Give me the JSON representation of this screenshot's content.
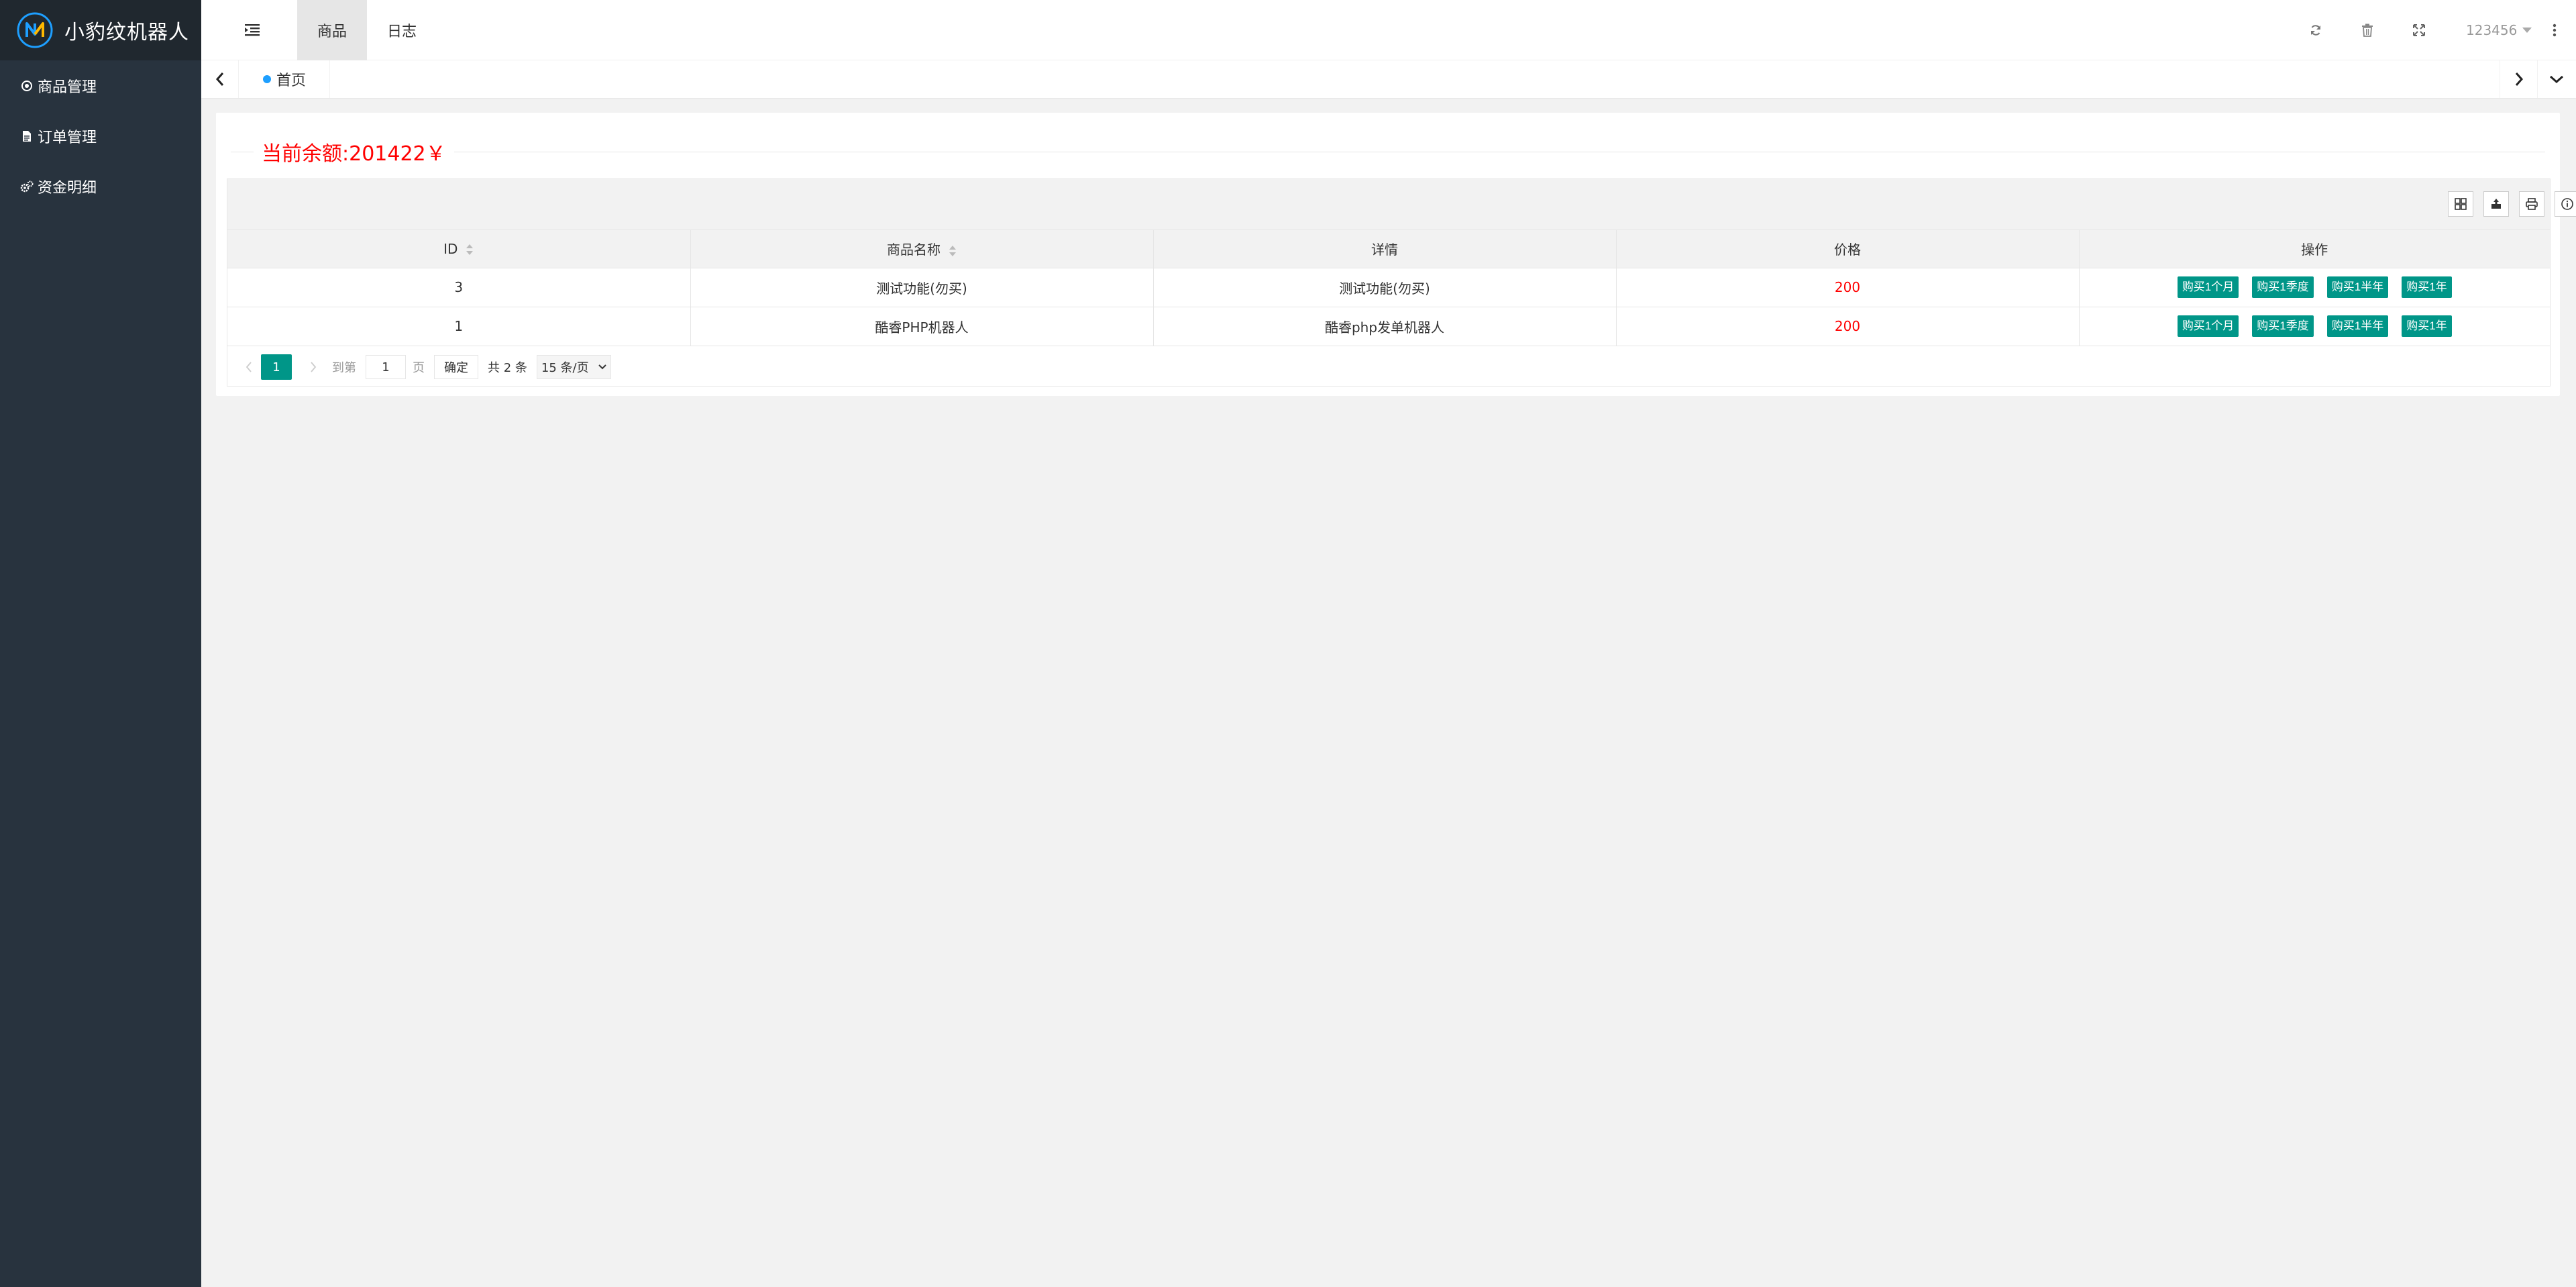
{
  "app": {
    "title": "小豹纹机器人"
  },
  "sidebar": {
    "items": [
      {
        "label": "商品管理",
        "icon": "circle-dot-icon"
      },
      {
        "label": "订单管理",
        "icon": "file-icon"
      },
      {
        "label": "资金明细",
        "icon": "gears-icon"
      }
    ]
  },
  "header": {
    "tabs": [
      {
        "label": "商品",
        "active": true
      },
      {
        "label": "日志",
        "active": false
      }
    ],
    "tools": [
      "refresh-icon",
      "trash-icon",
      "fullscreen-icon"
    ],
    "user": "123456"
  },
  "tabbar": {
    "home": "首页"
  },
  "balance": {
    "text": "当前余额:201422￥"
  },
  "table": {
    "columns": [
      {
        "label": "ID",
        "sortable": true
      },
      {
        "label": "商品名称",
        "sortable": true
      },
      {
        "label": "详情",
        "sortable": false
      },
      {
        "label": "价格",
        "sortable": false
      },
      {
        "label": "操作",
        "sortable": false
      }
    ],
    "rows": [
      {
        "id": "3",
        "name": "测试功能(勿买)",
        "detail": "测试功能(勿买)",
        "price": "200"
      },
      {
        "id": "1",
        "name": "酷睿PHP机器人",
        "detail": "酷睿php发单机器人",
        "price": "200"
      }
    ],
    "actions": [
      "购买1个月",
      "购买1季度",
      "购买1半年",
      "购买1年"
    ],
    "toolbar_icons": [
      "columns-icon",
      "export-icon",
      "print-icon",
      "info-icon"
    ]
  },
  "pager": {
    "current": "1",
    "goto_prefix": "到第",
    "goto_value": "1",
    "goto_suffix": "页",
    "confirm": "确定",
    "total": "共 2 条",
    "page_size": "15 条/页"
  },
  "colors": {
    "sidebar_bg": "#28333e",
    "logo_bg": "#20282f",
    "accent": "#009688",
    "price": "#ff0000",
    "home_dot": "#1e9fff"
  }
}
